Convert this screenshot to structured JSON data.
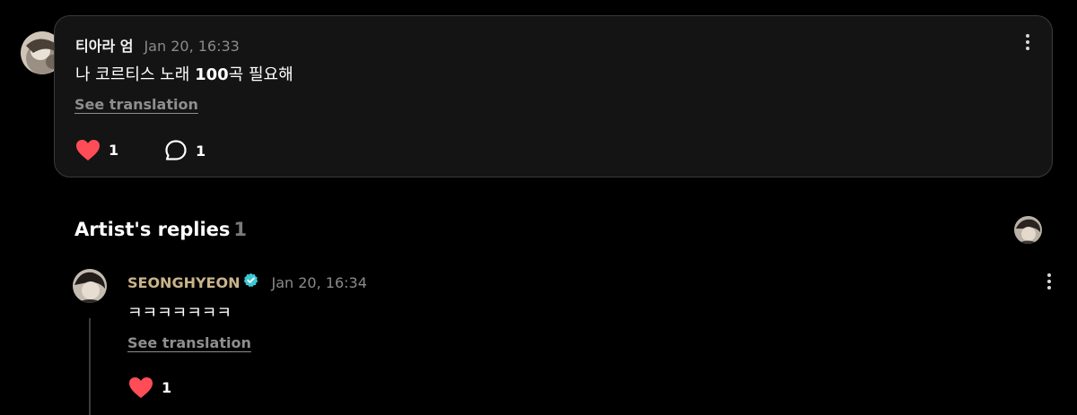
{
  "comment": {
    "author": "티아라 엄",
    "timestamp": "Jan 20, 16:33",
    "text_before": "나 코르티스 노래 ",
    "text_bold": "100",
    "text_after": "곡 필요해",
    "see_translation": "See translation",
    "like_count": "1",
    "reply_count": "1"
  },
  "artist_replies": {
    "title": "Artist's replies",
    "count": "1",
    "reply": {
      "author": "SEONGHYEON",
      "timestamp": "Jan 20, 16:34",
      "text": "ㅋㅋㅋㅋㅋㅋㅋ",
      "see_translation": "See translation",
      "like_count": "1"
    }
  },
  "colors": {
    "background": "#000000",
    "card_background": "#141414",
    "heart": "#ff4d57",
    "artist_name": "#c9b48a",
    "verified_badge": "#3fc7d4",
    "muted_text": "#8a8a8a"
  },
  "icons": {
    "like": "heart-icon",
    "reply": "speech-bubble-icon",
    "more": "kebab-menu-icon",
    "verified": "verified-badge-icon"
  }
}
